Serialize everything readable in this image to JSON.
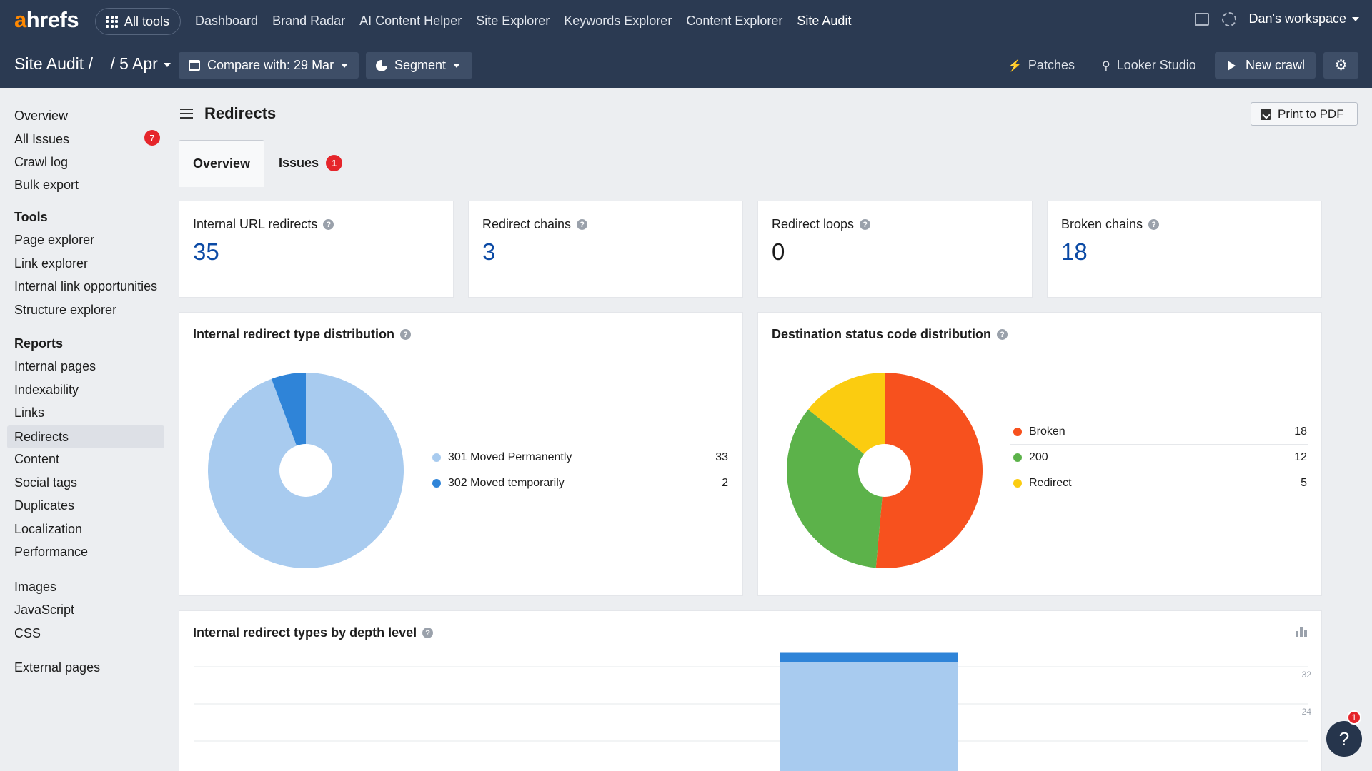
{
  "topnav": {
    "logo_a": "a",
    "logo_rest": "hrefs",
    "all_tools": "All tools",
    "items": [
      "Dashboard",
      "Brand Radar",
      "AI Content Helper",
      "Site Explorer",
      "Keywords Explorer",
      "Content Explorer",
      "Site Audit"
    ],
    "active": "Site Audit",
    "workspace": "Dan's workspace"
  },
  "subbar": {
    "title": "Site Audit",
    "sep": "/",
    "date": "/  5 Apr",
    "compare": "Compare with: 29 Mar",
    "segment": "Segment",
    "patches": "Patches",
    "looker": "Looker Studio",
    "new_crawl": "New crawl"
  },
  "sidebar": {
    "top": [
      "Overview",
      "All Issues",
      "Crawl log",
      "Bulk export"
    ],
    "all_issues_badge": "7",
    "tools_heading": "Tools",
    "tools": [
      "Page explorer",
      "Link explorer",
      "Internal link opportunities",
      "Structure explorer"
    ],
    "reports_heading": "Reports",
    "reports": [
      "Internal pages",
      "Indexability",
      "Links",
      "Redirects",
      "Content",
      "Social tags",
      "Duplicates",
      "Localization",
      "Performance"
    ],
    "assets": [
      "Images",
      "JavaScript",
      "CSS"
    ],
    "external": "External pages",
    "active": "Redirects"
  },
  "page": {
    "title": "Redirects",
    "print": "Print to PDF",
    "tabs": [
      {
        "label": "Overview"
      },
      {
        "label": "Issues",
        "badge": "1"
      }
    ]
  },
  "kpis": [
    {
      "label": "Internal URL redirects",
      "value": "35"
    },
    {
      "label": "Redirect chains",
      "value": "3"
    },
    {
      "label": "Redirect loops",
      "value": "0"
    },
    {
      "label": "Broken chains",
      "value": "18"
    }
  ],
  "redirect_types": {
    "title": "Internal redirect type distribution",
    "items": [
      {
        "label": "301 Moved Permanently",
        "value": 33,
        "color": "#a8cbef"
      },
      {
        "label": "302 Moved temporarily",
        "value": 2,
        "color": "#2f84d8"
      }
    ]
  },
  "destination_status": {
    "title": "Destination status code distribution",
    "items": [
      {
        "label": "Broken",
        "value": 18,
        "color": "#f7511e"
      },
      {
        "label": "200",
        "value": 12,
        "color": "#5cb24a"
      },
      {
        "label": "Redirect",
        "value": 5,
        "color": "#fbcc10"
      }
    ]
  },
  "depth": {
    "title": "Internal redirect types by depth level",
    "ticks": [
      "32",
      "24"
    ]
  },
  "chart_data": [
    {
      "type": "pie",
      "title": "Internal redirect type distribution",
      "categories": [
        "301 Moved Permanently",
        "302 Moved temporarily"
      ],
      "values": [
        33,
        2
      ]
    },
    {
      "type": "pie",
      "title": "Destination status code distribution",
      "categories": [
        "Broken",
        "200",
        "Redirect"
      ],
      "values": [
        18,
        12,
        5
      ]
    },
    {
      "type": "bar",
      "title": "Internal redirect types by depth level",
      "yticks": [
        24,
        32
      ],
      "series": [
        {
          "name": "301 Moved Permanently",
          "values": [
            33
          ]
        },
        {
          "name": "302 Moved temporarily",
          "values": [
            2
          ]
        }
      ]
    }
  ],
  "help_fab": {
    "label": "?",
    "badge": "1"
  }
}
